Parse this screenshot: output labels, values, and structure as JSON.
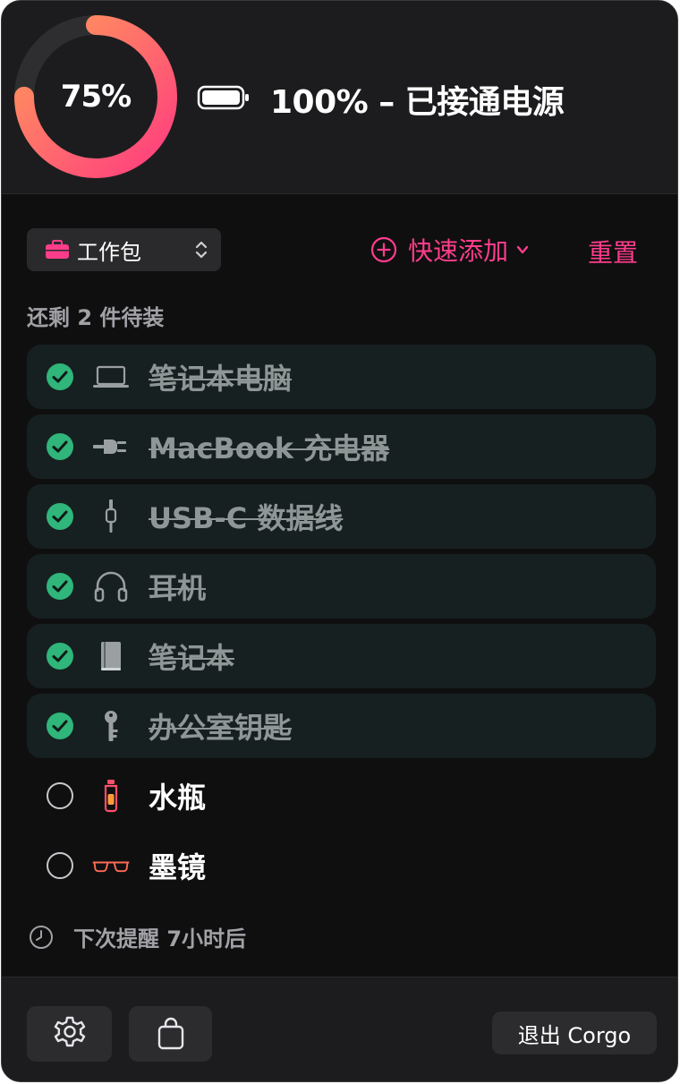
{
  "header": {
    "ring_percent": 75,
    "ring_label": "75%",
    "battery_level": 100,
    "battery_status": "100% – 已接通电源"
  },
  "toolbar": {
    "bag_selector": "工作包",
    "quick_add": "快速添加",
    "reset": "重置"
  },
  "remaining_text": "还剩 2 件待装",
  "items": [
    {
      "label": "笔记本电脑",
      "done": true,
      "icon": "laptop-icon"
    },
    {
      "label": "MacBook 充电器",
      "done": true,
      "icon": "plug-icon"
    },
    {
      "label": "USB-C 数据线",
      "done": true,
      "icon": "cable-icon"
    },
    {
      "label": "耳机",
      "done": true,
      "icon": "headphones-icon"
    },
    {
      "label": "笔记本",
      "done": true,
      "icon": "notebook-icon"
    },
    {
      "label": "办公室钥匙",
      "done": true,
      "icon": "key-icon"
    },
    {
      "label": "水瓶",
      "done": false,
      "icon": "water-bottle-icon"
    },
    {
      "label": "墨镜",
      "done": false,
      "icon": "sunglasses-icon"
    }
  ],
  "reminder": "下次提醒 7小时后",
  "footer": {
    "quit": "退出 Corgo"
  },
  "colors": {
    "accent": "#ff3d8b",
    "ring_start": "#ff9a5a",
    "ring_end": "#ff3d7f",
    "check_green": "#30b57a",
    "background": "#0f0f10"
  }
}
